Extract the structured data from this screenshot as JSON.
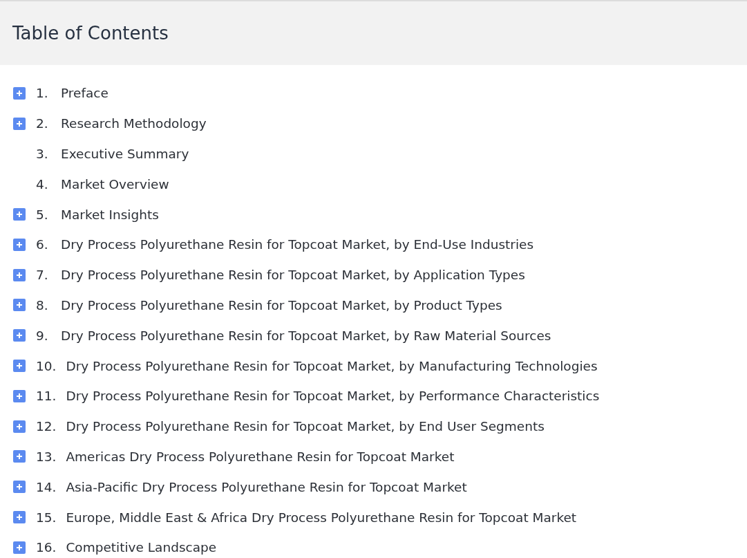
{
  "header": {
    "title": "Table of Contents"
  },
  "items": [
    {
      "number": "1.",
      "title": "Preface",
      "expandable": true
    },
    {
      "number": "2.",
      "title": "Research Methodology",
      "expandable": true
    },
    {
      "number": "3.",
      "title": "Executive Summary",
      "expandable": false
    },
    {
      "number": "4.",
      "title": "Market Overview",
      "expandable": false
    },
    {
      "number": "5.",
      "title": "Market Insights",
      "expandable": true
    },
    {
      "number": "6.",
      "title": "Dry Process Polyurethane Resin for Topcoat Market, by End-Use Industries",
      "expandable": true
    },
    {
      "number": "7.",
      "title": "Dry Process Polyurethane Resin for Topcoat Market, by Application Types",
      "expandable": true
    },
    {
      "number": "8.",
      "title": "Dry Process Polyurethane Resin for Topcoat Market, by Product Types",
      "expandable": true
    },
    {
      "number": "9.",
      "title": "Dry Process Polyurethane Resin for Topcoat Market, by Raw Material Sources",
      "expandable": true
    },
    {
      "number": "10.",
      "title": "Dry Process Polyurethane Resin for Topcoat Market, by Manufacturing Technologies",
      "expandable": true
    },
    {
      "number": "11.",
      "title": "Dry Process Polyurethane Resin for Topcoat Market, by Performance Characteristics",
      "expandable": true
    },
    {
      "number": "12.",
      "title": "Dry Process Polyurethane Resin for Topcoat Market, by End User Segments",
      "expandable": true
    },
    {
      "number": "13.",
      "title": "Americas Dry Process Polyurethane Resin for Topcoat Market",
      "expandable": true
    },
    {
      "number": "14.",
      "title": "Asia-Pacific Dry Process Polyurethane Resin for Topcoat Market",
      "expandable": true
    },
    {
      "number": "15.",
      "title": "Europe, Middle East & Africa Dry Process Polyurethane Resin for Topcoat Market",
      "expandable": true
    },
    {
      "number": "16.",
      "title": "Competitive Landscape",
      "expandable": true
    }
  ]
}
